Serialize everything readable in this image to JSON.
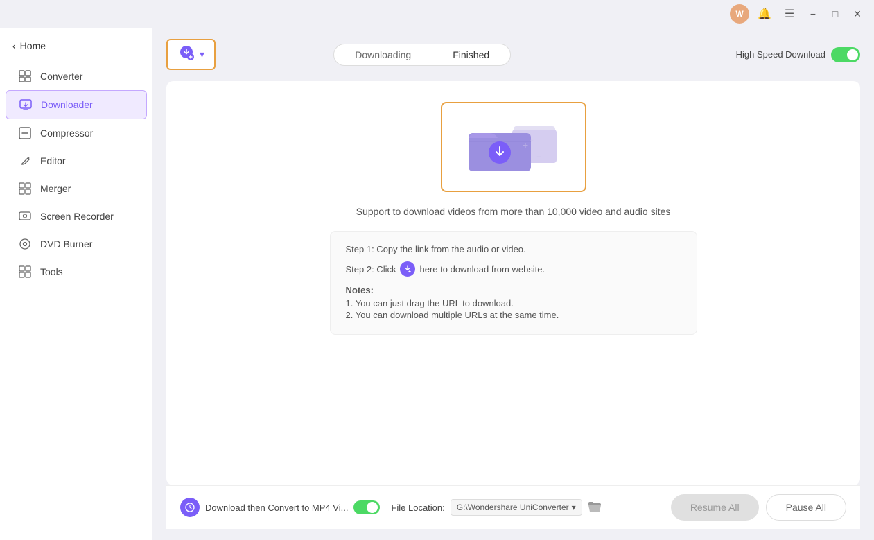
{
  "titlebar": {
    "avatar_text": "W",
    "bell_icon": "🔔",
    "menu_icon": "☰",
    "min_label": "−",
    "max_label": "□",
    "close_label": "✕"
  },
  "sidebar": {
    "back_label": "Home",
    "items": [
      {
        "id": "converter",
        "label": "Converter",
        "icon": "⊞"
      },
      {
        "id": "downloader",
        "label": "Downloader",
        "icon": "🖥",
        "active": true
      },
      {
        "id": "compressor",
        "label": "Compressor",
        "icon": "⊟"
      },
      {
        "id": "editor",
        "label": "Editor",
        "icon": "✂"
      },
      {
        "id": "merger",
        "label": "Merger",
        "icon": "⊞"
      },
      {
        "id": "screen-recorder",
        "label": "Screen Recorder",
        "icon": "📷"
      },
      {
        "id": "dvd-burner",
        "label": "DVD Burner",
        "icon": "⊙"
      },
      {
        "id": "tools",
        "label": "Tools",
        "icon": "⊞"
      }
    ]
  },
  "toolbar": {
    "add_button_label": "▾",
    "tabs": [
      {
        "id": "downloading",
        "label": "Downloading",
        "active": false
      },
      {
        "id": "finished",
        "label": "Finished",
        "active": false
      }
    ],
    "speed_label": "High Speed Download"
  },
  "content": {
    "support_text": "Support to download videos from more than 10,000 video and audio sites",
    "step1": "Step 1: Copy the link from the audio or video.",
    "step2_prefix": "Step 2: Click",
    "step2_suffix": "here to download from website.",
    "notes_title": "Notes:",
    "note1": "1. You can just drag the URL to download.",
    "note2": "2. You can download multiple URLs at the same time."
  },
  "bottom": {
    "convert_label": "Download then Convert to MP4 Vi...",
    "file_location_label": "File Location:",
    "file_path": "G:\\Wondershare UniConverter",
    "resume_label": "Resume All",
    "pause_label": "Pause All"
  }
}
